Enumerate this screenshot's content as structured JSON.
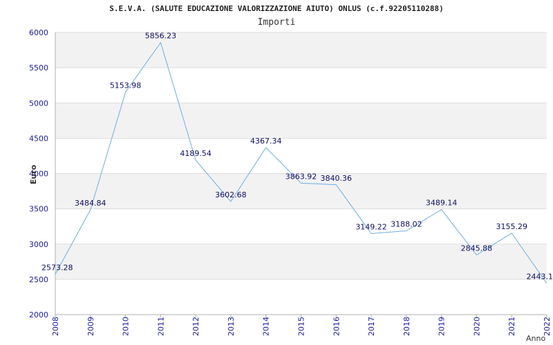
{
  "chart_data": {
    "type": "line",
    "title": "S.E.V.A. (SALUTE EDUCAZIONE VALORIZZAZIONE AIUTO) ONLUS (c.f.92205110288)",
    "subtitle": "Importi",
    "xlabel": "Anno",
    "ylabel": "Euro",
    "ylim": [
      2000,
      6000
    ],
    "yticks": [
      2000,
      2500,
      3000,
      3500,
      4000,
      4500,
      5000,
      5500,
      6000
    ],
    "x": [
      "2008",
      "2009",
      "2010",
      "2011",
      "2012",
      "2013",
      "2014",
      "2015",
      "2016",
      "2017",
      "2018",
      "2019",
      "2020",
      "2021",
      "2022"
    ],
    "series": [
      {
        "values": [
          2573.28,
          3484.84,
          5153.98,
          5856.23,
          4189.54,
          3602.68,
          4367.34,
          3863.92,
          3840.36,
          3149.22,
          3188.02,
          3489.14,
          2845.88,
          3155.29,
          2443.1
        ],
        "labels": [
          "2573.28",
          "3484.84",
          "5153.98",
          "5856.23",
          "4189.54",
          "3602.68",
          "4367.34",
          "3863.92",
          "3840.36",
          "3149.22",
          "3188.02",
          "3489.14",
          "2845.88",
          "3155.29",
          "2443.1"
        ]
      }
    ],
    "grid": true,
    "colors": {
      "line": "#6aaee8",
      "band": "#f2f2f2",
      "tick_text": "#1a1aa6",
      "label_text": "#0d0d6b",
      "axis": "#b0b0b0"
    }
  }
}
